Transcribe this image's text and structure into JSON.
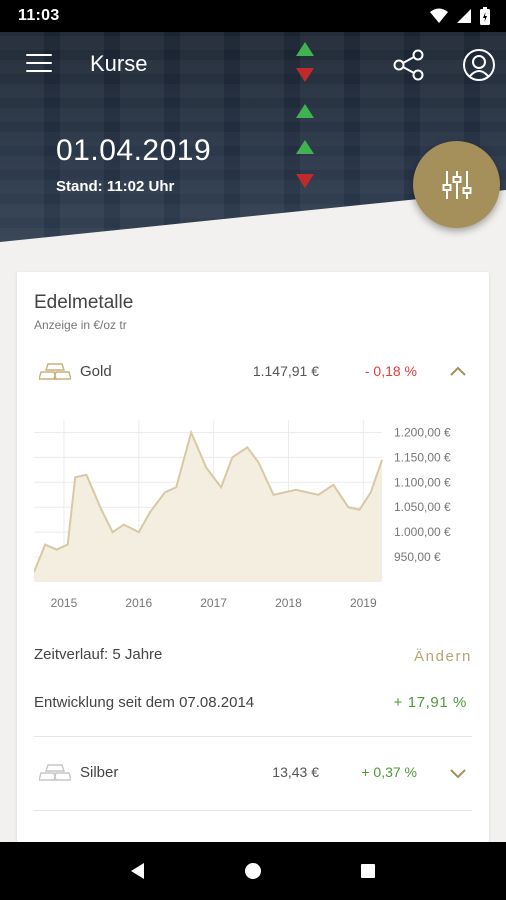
{
  "status_bar": {
    "time": "11:03"
  },
  "header": {
    "title": "Kurse"
  },
  "hero": {
    "date": "01.04.2019",
    "stand": "Stand: 11:02 Uhr"
  },
  "card": {
    "title": "Edelmetalle",
    "subtitle": "Anzeige in €/oz tr",
    "gold": {
      "name": "Gold",
      "price": "1.147,91 €",
      "change": "- 0,18 %",
      "change_color": "#e23b3b"
    },
    "silber": {
      "name": "Silber",
      "price": "13,43 €",
      "change": "+ 0,37 %",
      "change_color": "#4d9a3a"
    },
    "zeitverlauf": "Zeitverlauf: 5 Jahre",
    "aendern": "Ändern",
    "entwicklung": "Entwicklung seit dem 07.08.2014",
    "entwicklung_value": "+ 17,91 %"
  },
  "colors": {
    "accent": "#a58f5a",
    "chart_fill": "#f4eee1",
    "chart_line": "#d8c9a5"
  },
  "chart_data": {
    "type": "area",
    "title": "",
    "xlabel": "",
    "ylabel": "",
    "x_ticks": [
      "2015",
      "2016",
      "2017",
      "2018",
      "2019"
    ],
    "y_ticks": [
      "1.200,00 €",
      "1.150,00 €",
      "1.100,00 €",
      "1.050,00 €",
      "1.000,00 €",
      "950,00 €"
    ],
    "ylim": [
      900,
      1225
    ],
    "series": [
      {
        "x": [
          2014.6,
          2014.75,
          2014.9,
          2015.05,
          2015.15,
          2015.3,
          2015.5,
          2015.65,
          2015.8,
          2016.0,
          2016.15,
          2016.35,
          2016.5,
          2016.7,
          2016.9,
          2017.1,
          2017.25,
          2017.45,
          2017.6,
          2017.8,
          2017.95,
          2018.1,
          2018.4,
          2018.6,
          2018.8,
          2018.95,
          2019.1,
          2019.25
        ],
        "values": [
          920,
          975,
          965,
          975,
          1110,
          1115,
          1045,
          1000,
          1015,
          1000,
          1040,
          1080,
          1090,
          1200,
          1130,
          1090,
          1150,
          1170,
          1140,
          1075,
          1080,
          1085,
          1075,
          1095,
          1050,
          1045,
          1080,
          1145
        ]
      }
    ]
  }
}
